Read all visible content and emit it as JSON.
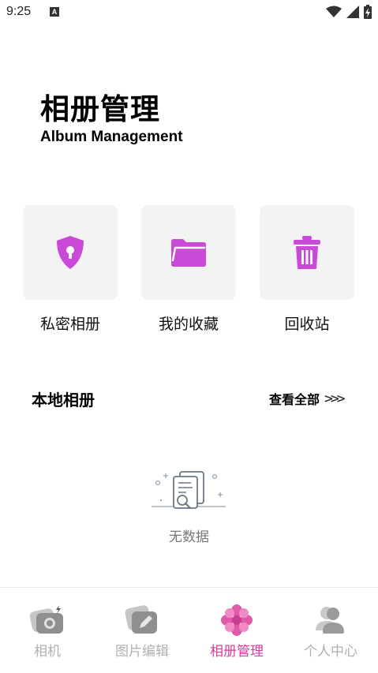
{
  "status_bar": {
    "time": "9:25",
    "notification_glyph": "A",
    "icons": [
      "wifi-icon",
      "cell-signal-icon",
      "battery-charging-icon"
    ]
  },
  "header": {
    "title": "相册管理",
    "subtitle": "Album Management"
  },
  "actions": [
    {
      "label": "私密相册",
      "icon": "shield-lock-icon"
    },
    {
      "label": "我的收藏",
      "icon": "folder-icon"
    },
    {
      "label": "回收站",
      "icon": "trash-icon"
    }
  ],
  "local_albums": {
    "title": "本地相册",
    "view_all": "查看全部",
    "view_all_arrows": ">>>",
    "empty_text": "无数据"
  },
  "tabs": [
    {
      "label": "相机",
      "icon": "camera-icon",
      "active": false
    },
    {
      "label": "图片编辑",
      "icon": "edit-photo-icon",
      "active": false
    },
    {
      "label": "相册管理",
      "icon": "album-flower-icon",
      "active": true
    },
    {
      "label": "个人中心",
      "icon": "user-icon",
      "active": false
    }
  ],
  "colors": {
    "accent": "#d63c9e",
    "icon_purple": "#c94ad6",
    "card_bg": "#f3f3f3",
    "inactive": "#b0b0b0"
  }
}
